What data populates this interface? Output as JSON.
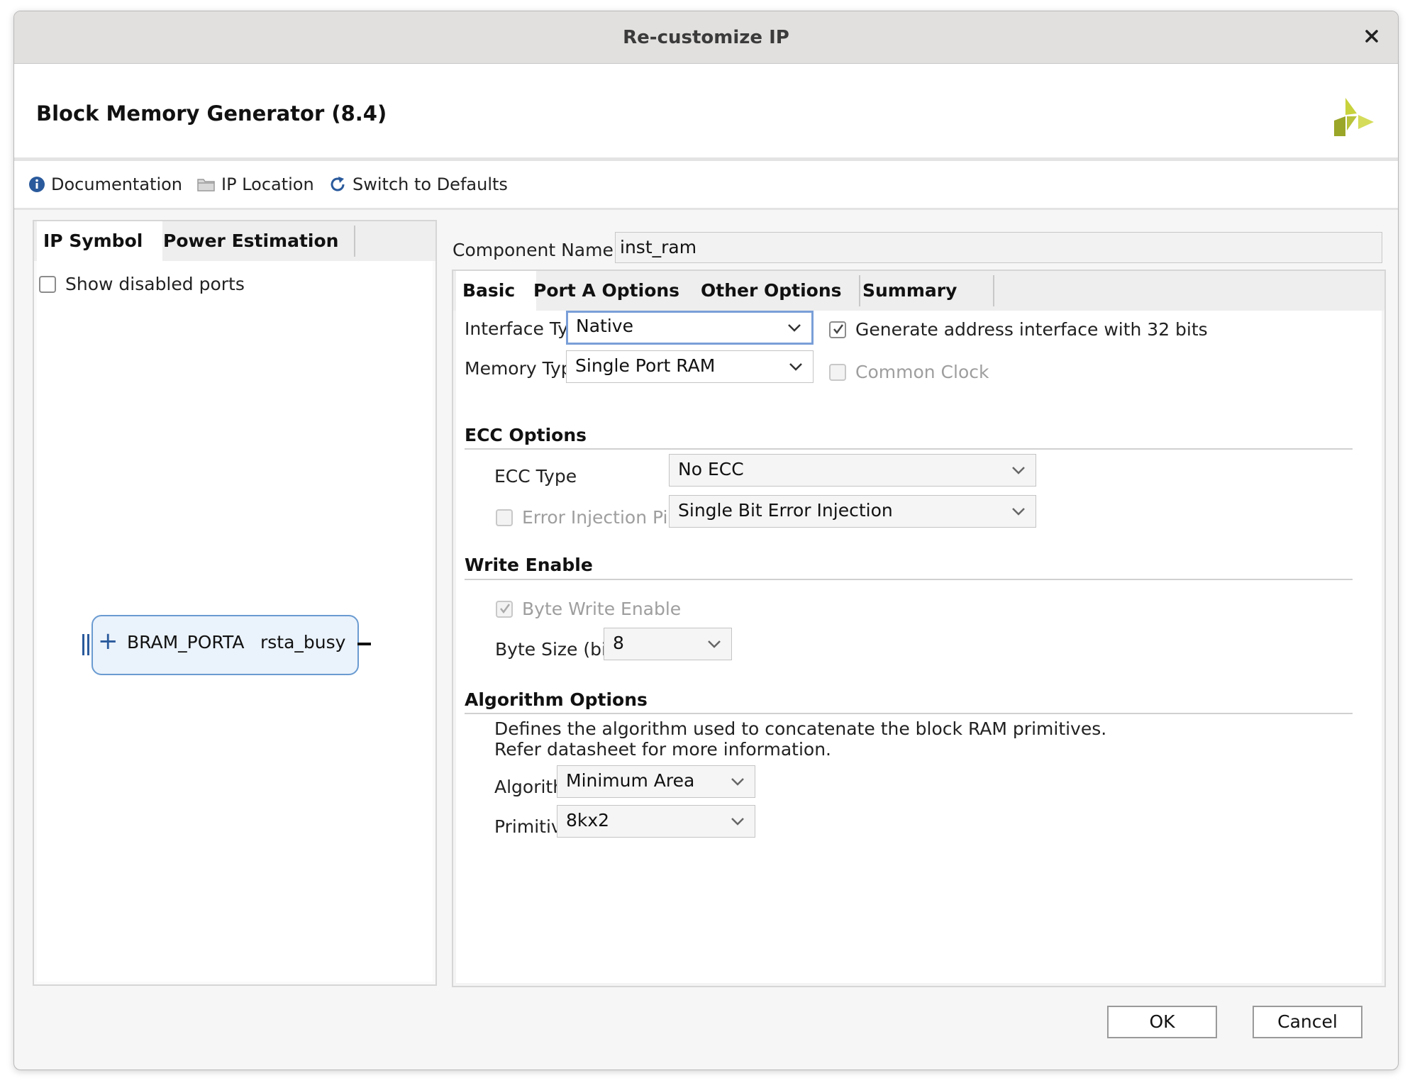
{
  "window": {
    "title": "Re-customize IP"
  },
  "header": {
    "title": "Block Memory Generator (8.4)"
  },
  "toolbar": {
    "documentation": "Documentation",
    "ip_location": "IP Location",
    "switch_defaults": "Switch to Defaults"
  },
  "left_panel": {
    "tabs": [
      {
        "label": "IP Symbol"
      },
      {
        "label": "Power Estimation"
      }
    ],
    "show_disabled_ports": "Show disabled ports",
    "symbol": {
      "port_a": "BRAM_PORTA",
      "busy": "rsta_busy"
    }
  },
  "component": {
    "label": "Component Name",
    "value": "inst_ram"
  },
  "tabs": [
    {
      "label": "Basic"
    },
    {
      "label": "Port A Options"
    },
    {
      "label": "Other Options"
    },
    {
      "label": "Summary"
    }
  ],
  "basic": {
    "interface_type_label": "Interface Type",
    "interface_type_value": "Native",
    "memory_type_label": "Memory Type",
    "memory_type_value": "Single Port RAM",
    "gen_addr_label": "Generate address interface with 32 bits",
    "common_clock_label": "Common Clock"
  },
  "ecc": {
    "title": "ECC Options",
    "type_label": "ECC Type",
    "type_value": "No ECC",
    "error_pins_label": "Error Injection Pins",
    "error_pins_value": "Single Bit Error Injection"
  },
  "write_enable": {
    "title": "Write Enable",
    "byte_write_label": "Byte Write Enable",
    "byte_size_label": "Byte Size (bits)",
    "byte_size_value": "8"
  },
  "algorithm": {
    "title": "Algorithm Options",
    "desc1": "Defines the algorithm used to concatenate the block RAM primitives.",
    "desc2": "Refer datasheet for more information.",
    "algorithm_label": "Algorithm",
    "algorithm_value": "Minimum Area",
    "primitive_label": "Primitive",
    "primitive_value": "8kx2"
  },
  "footer": {
    "ok": "OK",
    "cancel": "Cancel"
  },
  "colors": {
    "accent": "#7a9fd8",
    "symbol_fill": "#eaf2fb",
    "logo": "#b8c23a"
  }
}
